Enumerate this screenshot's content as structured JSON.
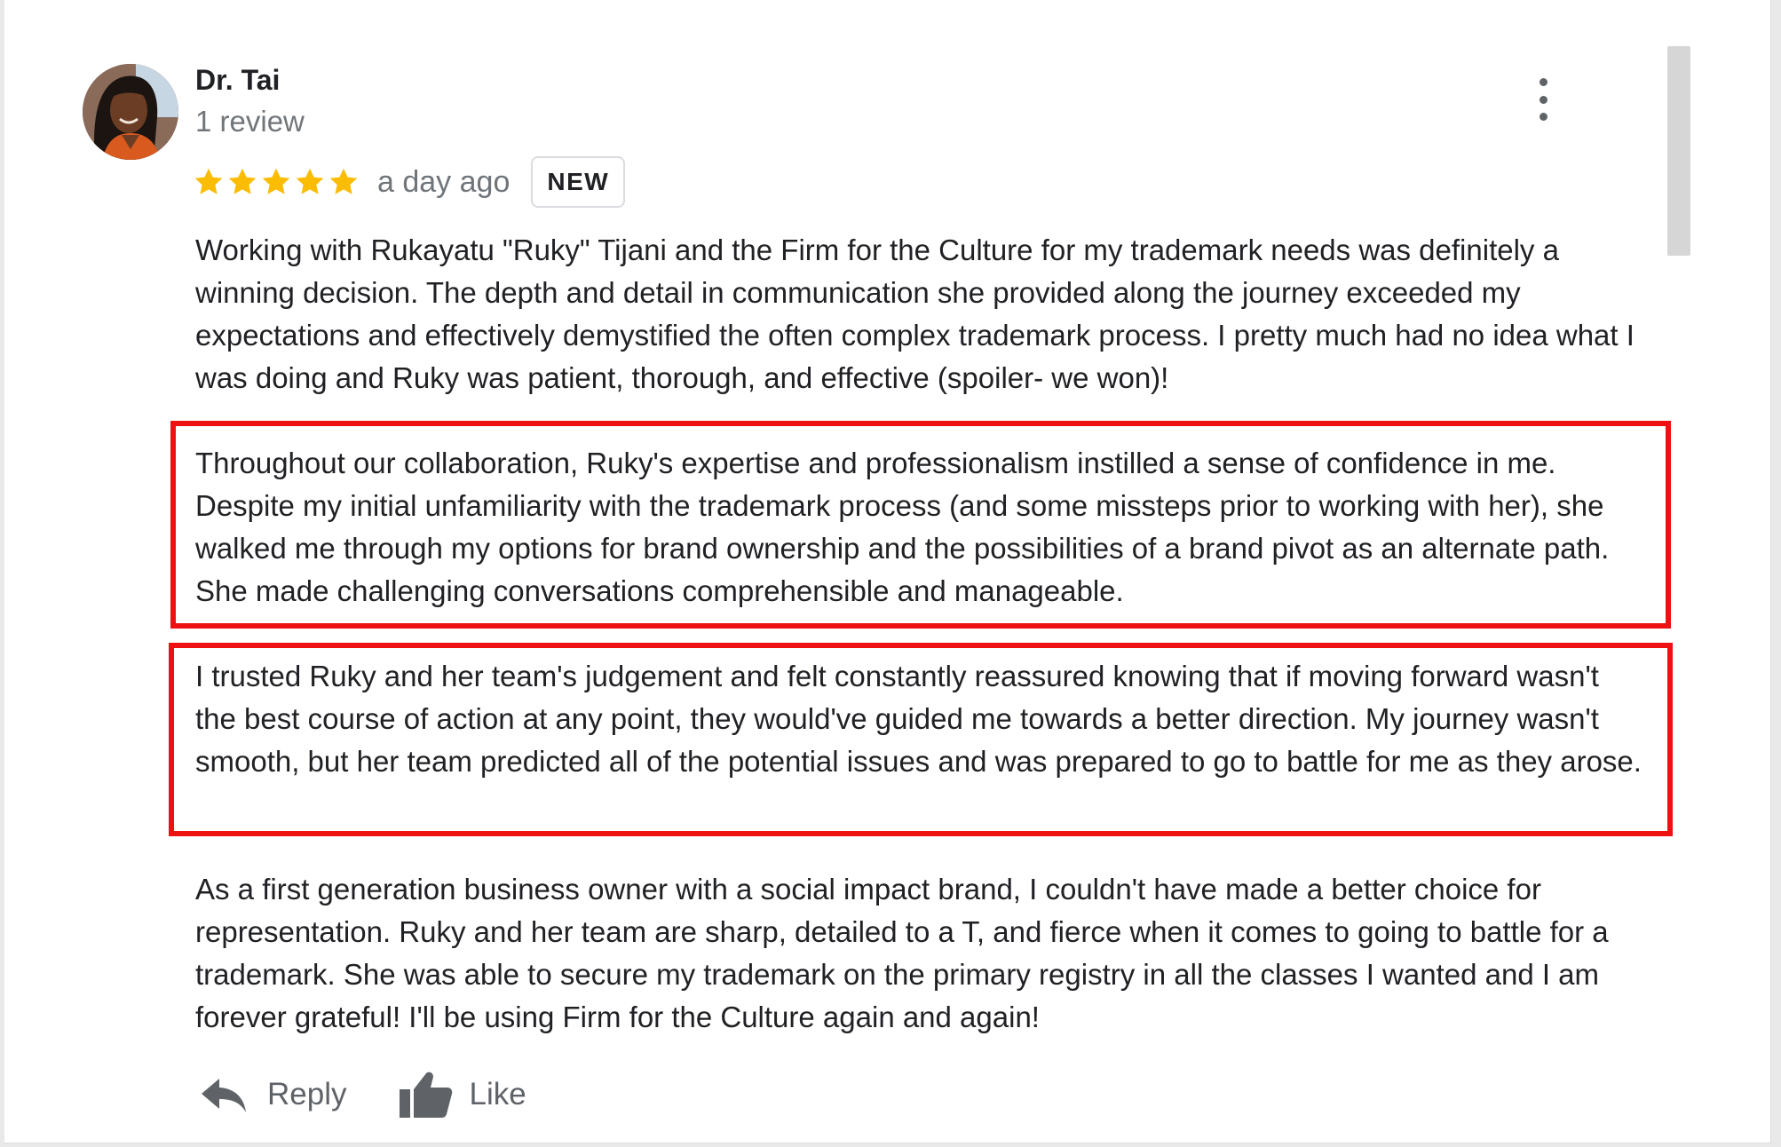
{
  "review": {
    "author": {
      "name": "Dr. Tai",
      "review_count": "1 review",
      "avatar_icon": "user-avatar-photo"
    },
    "rating": {
      "stars": 5,
      "max_stars": 5,
      "star_color": "#fbbc04",
      "star_icon": "star-icon"
    },
    "time_ago": "a day ago",
    "badge": "NEW",
    "menu_icon": "more-vertical-icon",
    "paragraphs": [
      "Working with Rukayatu \"Ruky\" Tijani and the Firm for the Culture for my trademark needs was definitely a winning decision. The depth and detail in communication she provided along the journey exceeded my expectations and effectively demystified the often complex trademark process. I pretty much had no idea what I was doing and Ruky was patient, thorough, and effective (spoiler- we won)!",
      "Throughout our collaboration, Ruky's expertise and professionalism instilled a sense of confidence in me. Despite my initial unfamiliarity with the trademark process (and some missteps prior to working with her), she walked me through my options for brand ownership and the possibilities of a brand pivot as an alternate path. She made challenging conversations comprehensible and manageable.",
      "I trusted Ruky and her team's judgement and felt constantly reassured knowing that if moving forward wasn't the best course of action at any point, they would've guided me towards a better direction. My journey wasn't smooth, but her team predicted all of the potential issues and was prepared to go to battle for me as they arose.",
      "As a first generation business owner with a social impact brand, I couldn't have made a better choice for representation. Ruky and her team are sharp, detailed to a T, and fierce when it comes to going to battle for a trademark. She was able to secure my trademark on the primary registry in all the classes I wanted and I am forever grateful! I'll be using Firm for the Culture again and again!"
    ],
    "highlight_color": "#ee1111"
  },
  "actions": {
    "reply_label": "Reply",
    "reply_icon": "reply-arrow-icon",
    "like_label": "Like",
    "like_icon": "thumbs-up-icon"
  },
  "colors": {
    "text_primary": "#202124",
    "text_secondary": "#70757a",
    "icon_gray": "#5f6368",
    "badge_border": "#dadce0"
  }
}
